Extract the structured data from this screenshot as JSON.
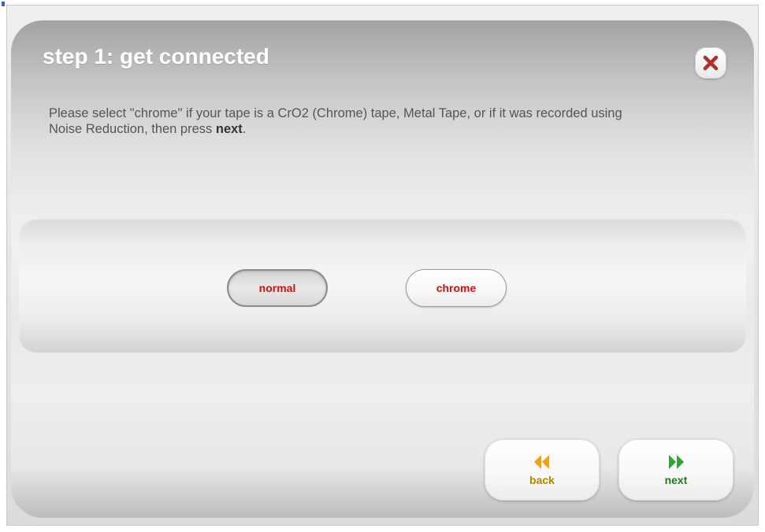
{
  "dialog": {
    "title": "step 1: get connected",
    "description_part1": "Please select \"chrome\" if your tape is a CrO2 (Chrome) tape, Metal Tape, or if it was recorded using Noise Reduction, then press ",
    "description_bold": "next",
    "description_end": "."
  },
  "options": [
    {
      "label": "normal",
      "selected": true
    },
    {
      "label": "chrome",
      "selected": false
    }
  ],
  "nav": {
    "back_label": "back",
    "next_label": "next"
  },
  "colors": {
    "close_x": "#b32d2d",
    "option_text": "#cc1111",
    "back_arrow": "#f0a020",
    "next_arrow": "#2aaa2a"
  },
  "icons": {
    "close": "close-icon",
    "back": "double-chevron-left-icon",
    "next": "double-chevron-right-icon"
  }
}
